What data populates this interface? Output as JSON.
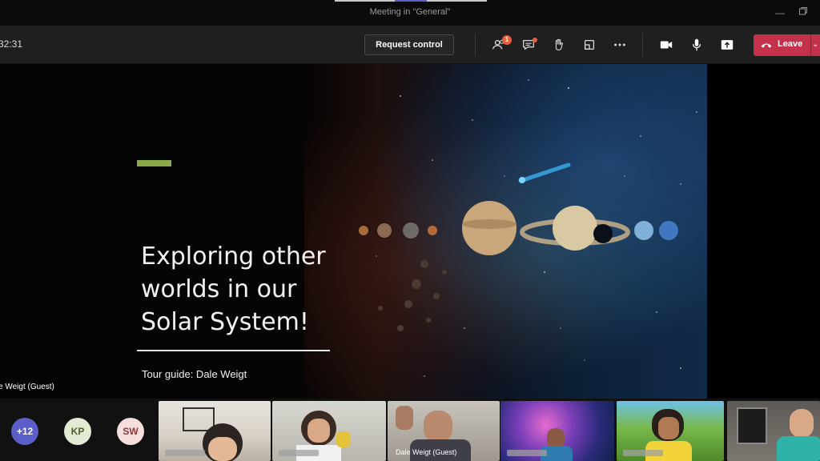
{
  "window": {
    "title": "Meeting in \"General\""
  },
  "toolbar": {
    "timer": "32:31",
    "request_control_label": "Request control",
    "participants_badge": "1",
    "leave_label": "Leave",
    "icons": [
      "participants-icon",
      "chat-icon",
      "raise-hand-icon",
      "share-tray-icon",
      "more-options-icon",
      "camera-icon",
      "mic-icon",
      "share-screen-icon",
      "phone-icon"
    ]
  },
  "slide": {
    "title_line1": "Exploring other",
    "title_line2": "worlds in our",
    "title_line3": "Solar System!",
    "subtitle": "Tour guide: Dale Weigt",
    "presenter_label": "e Weigt (Guest)"
  },
  "gallery": {
    "overflow_count": "+12",
    "avatars": [
      {
        "initials": "KP",
        "bg": "#e3ead4",
        "fg": "#4e5f2c"
      },
      {
        "initials": "SW",
        "bg": "#f6dede",
        "fg": "#8a3a3a"
      }
    ],
    "video_tiles": [
      {
        "label": ""
      },
      {
        "label": ""
      },
      {
        "label": "Dale Weigt (Guest)"
      },
      {
        "label": ""
      },
      {
        "label": ""
      },
      {
        "label": ""
      }
    ]
  },
  "colors": {
    "leave": "#c4314b",
    "accent_bar": "#8ba84a",
    "badge": "#e8603c",
    "overflow_avatar": "#5b5fc7"
  }
}
